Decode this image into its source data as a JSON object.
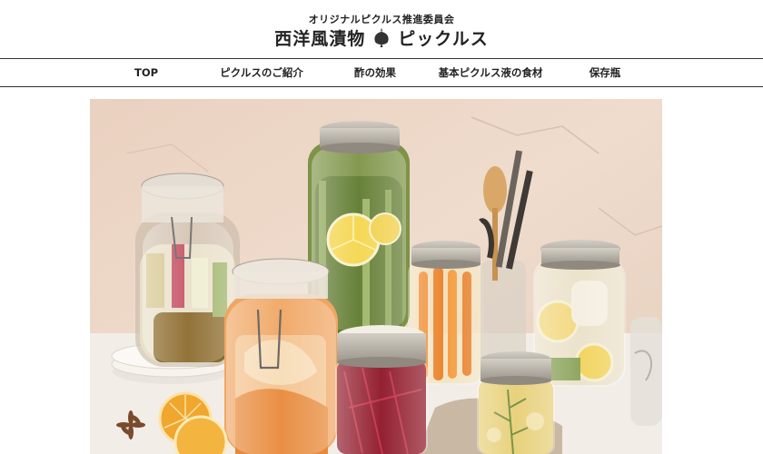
{
  "header": {
    "tagline": "オリジナルピクルス推進委員会",
    "logo_left": "西洋風漬物",
    "logo_right": "ピックルス",
    "logo_icon": "onion-icon"
  },
  "nav": {
    "items": [
      {
        "label": "TOP"
      },
      {
        "label": "ピクルスのご紹介"
      },
      {
        "label": "酢の効果"
      },
      {
        "label": "基本ピクルス液の食材"
      },
      {
        "label": "保存瓶"
      }
    ]
  },
  "hero": {
    "image": "pickle-jars-photo",
    "colors": {
      "wall": "#ecd9c9",
      "table": "#f3efea",
      "lid": "#b9b3a8",
      "carrot": "#f08a2c",
      "beet": "#9c1a2a",
      "lemon": "#f2c93a",
      "green": "#6f8a3a"
    }
  }
}
